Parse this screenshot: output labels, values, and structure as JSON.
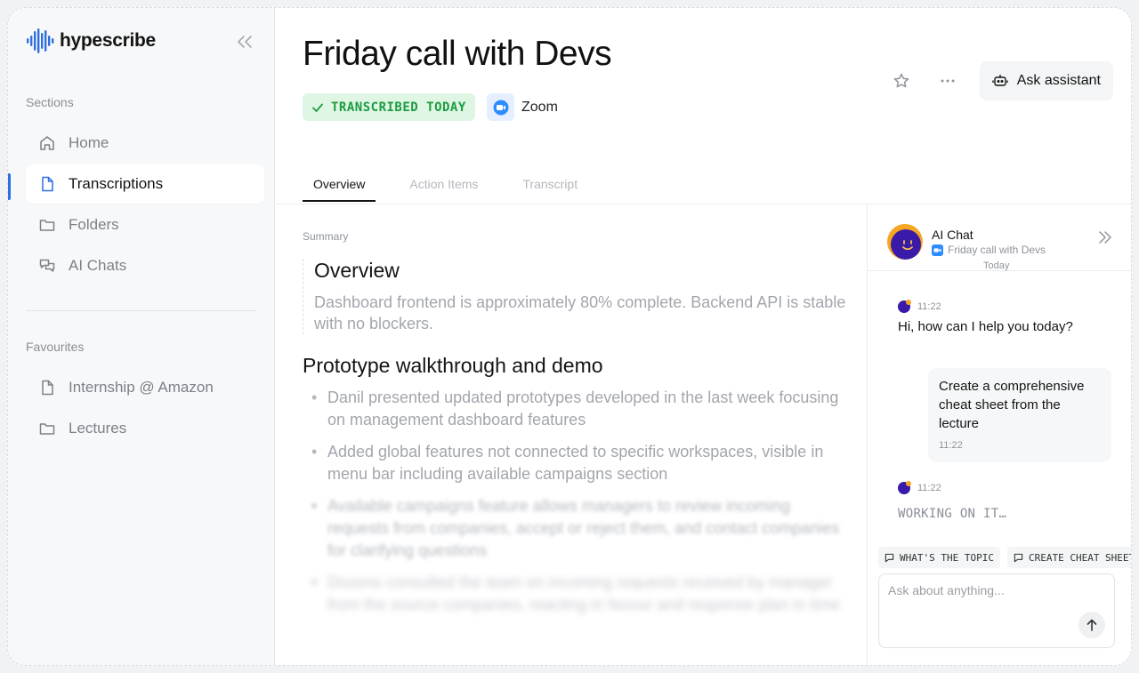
{
  "brand": {
    "name": "hypescribe",
    "accent": "#2f6fe0"
  },
  "sidebar": {
    "sections_label": "Sections",
    "items": [
      {
        "label": "Home",
        "icon": "home-icon"
      },
      {
        "label": "Transcriptions",
        "icon": "document-icon",
        "active": true
      },
      {
        "label": "Folders",
        "icon": "folder-icon"
      },
      {
        "label": "AI Chats",
        "icon": "chat-icon"
      }
    ],
    "favourites_label": "Favourites",
    "favourites": [
      {
        "label": "Internship @ Amazon",
        "icon": "document-icon"
      },
      {
        "label": "Lectures",
        "icon": "folder-icon"
      }
    ]
  },
  "header": {
    "title": "Friday call with Devs",
    "badge": "TRANSCRIBED TODAY",
    "source": "Zoom",
    "ask_assistant": "Ask assistant"
  },
  "tabs": [
    "Overview",
    "Action Items",
    "Transcript"
  ],
  "summary": {
    "label": "Summary",
    "overview_title": "Overview",
    "overview_text": "Dashboard frontend is approximately 80% complete. Backend API is stable with no blockers.",
    "section_title": "Prototype walkthrough and demo",
    "bullets": [
      "Danil presented updated prototypes developed in the last week focusing on management dashboard features",
      "Added global features not connected to specific workspaces, visible in menu bar including available campaigns section",
      "Available campaigns feature allows managers to review incoming requests from companies, accept or reject them, and contact companies for clarifying questions",
      "Dozens consulted the team on incoming requests received by manager from the source companies, reacting in favour and response plan in time"
    ]
  },
  "chat": {
    "title": "AI Chat",
    "subtitle": "Friday call with Devs",
    "date": "Today",
    "messages": [
      {
        "role": "bot",
        "time": "11:22",
        "text": "Hi, how can I help you today?"
      },
      {
        "role": "user",
        "time": "11:22",
        "text": "Create a comprehensive cheat sheet from the lecture"
      },
      {
        "role": "bot",
        "time": "11:22",
        "text": "WORKING ON IT…"
      }
    ],
    "chips": [
      "WHAT'S THE TOPIC",
      "CREATE CHEAT SHEET"
    ],
    "input_placeholder": "Ask about anything..."
  }
}
